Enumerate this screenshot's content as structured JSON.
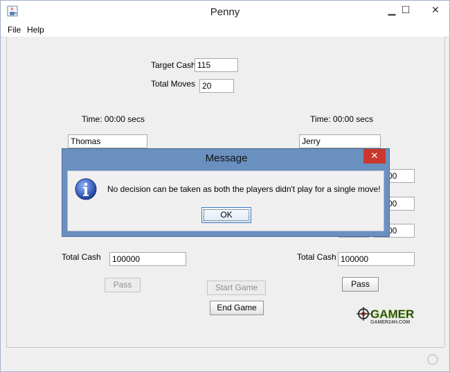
{
  "window": {
    "title": "Penny",
    "minimize_glyph": "▁",
    "maximize_glyph": "☐",
    "close_glyph": "✕",
    "icon": "java-coffee-icon"
  },
  "menu": {
    "file": "File",
    "help": "Help"
  },
  "game": {
    "target_cash_label": "Target Cash",
    "target_cash_value": "115",
    "total_moves_label": "Total Moves",
    "total_moves_value": "20"
  },
  "left_player": {
    "time_label": "Time:",
    "time_value": "00:00 secs",
    "name": "Thomas",
    "total_cash_label": "Total Cash",
    "total_cash_value": "100000",
    "pass_label": "Pass"
  },
  "right_player": {
    "time_label": "Time:",
    "time_value": "00:00 secs",
    "name": "Jerry",
    "field1_partial": "00",
    "field2_partial": "00",
    "field3_partial": "00",
    "total_cash_label": "Total Cash",
    "total_cash_value": "100000",
    "pass_label": "Pass"
  },
  "controls": {
    "start_game": "Start Game",
    "end_game": "End Game"
  },
  "dialog": {
    "title": "Message",
    "close_glyph": "✕",
    "message": "No decision can be taken as both the players didn't play for a single move!",
    "ok_label": "OK",
    "icon": "info-icon"
  },
  "watermark": {
    "main": "GAMER",
    "sub": "GAMER24H.COM"
  },
  "colors": {
    "dialog_frame": "#6a90c0",
    "close_red": "#c9382c",
    "window_bg": "#f0f0f0"
  }
}
